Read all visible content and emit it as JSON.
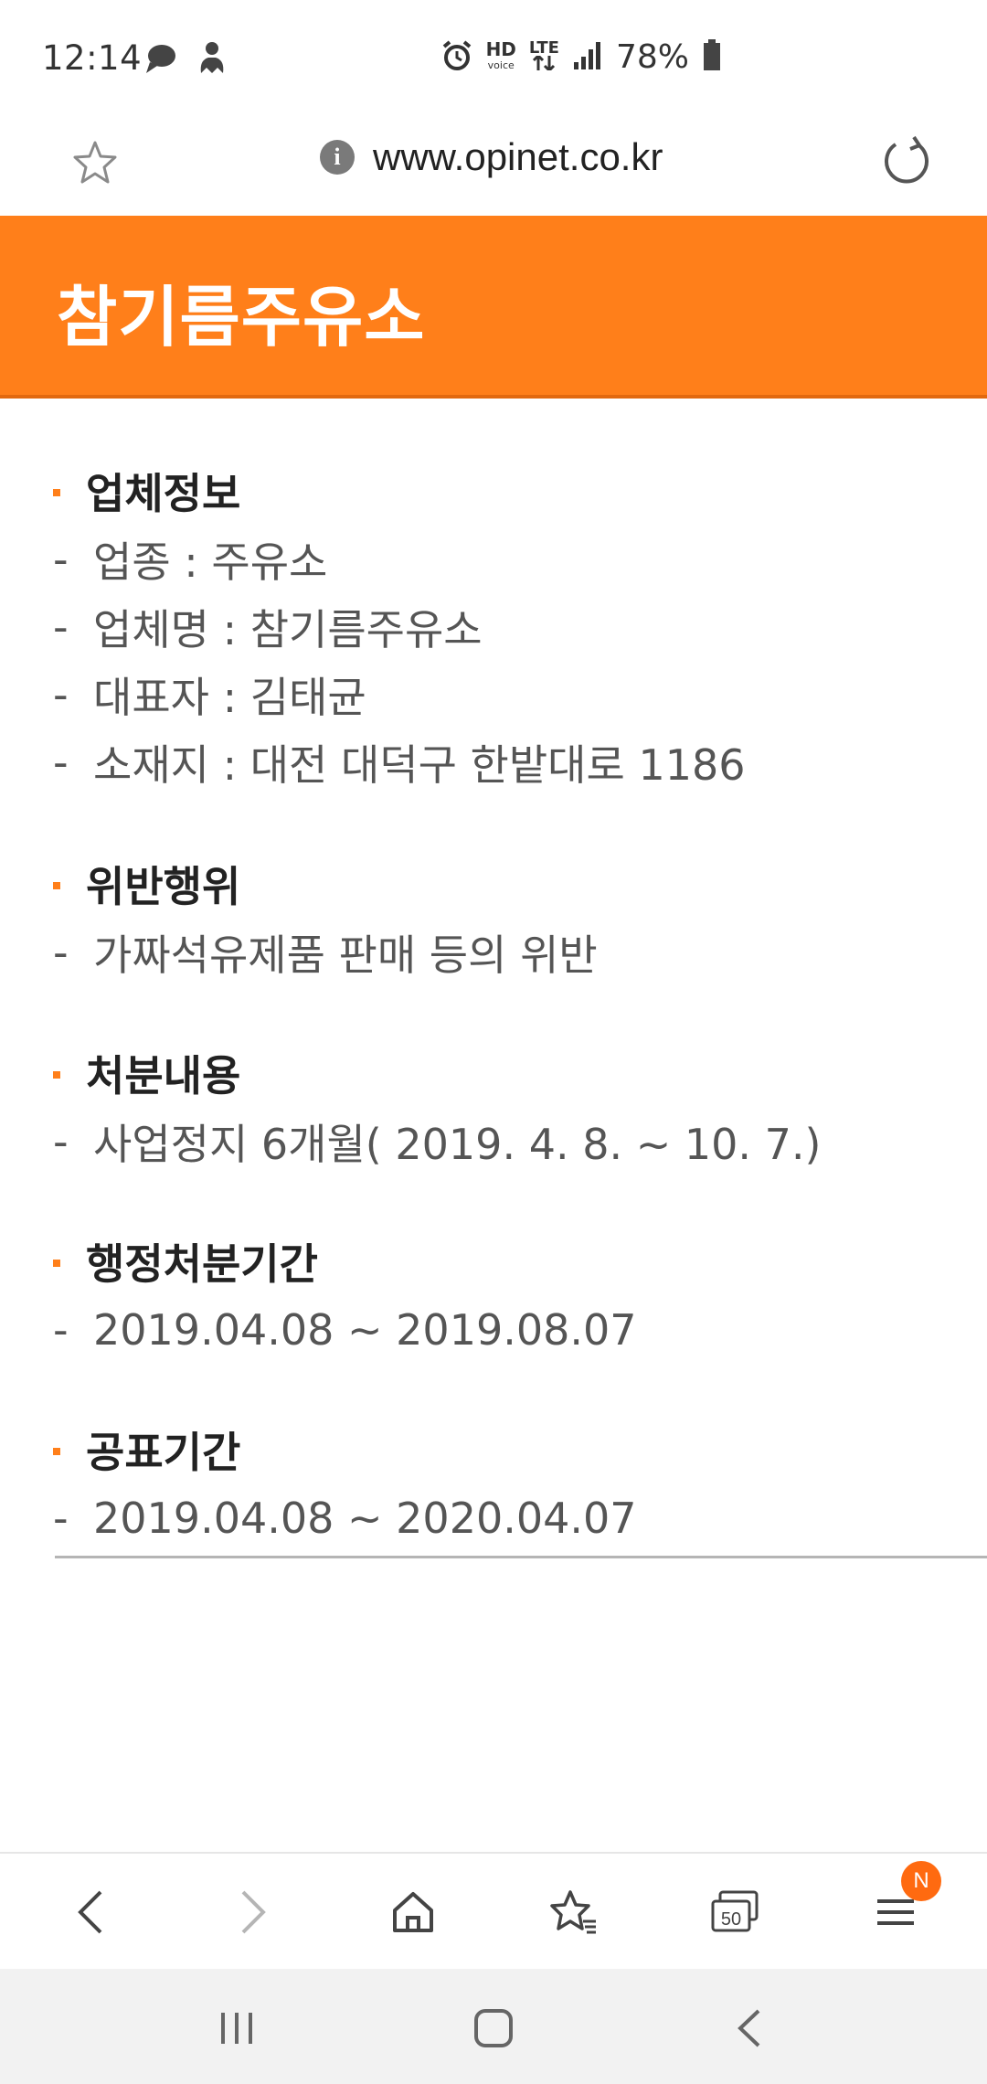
{
  "status_bar": {
    "time": "12:14",
    "battery": "78%",
    "left_icons": [
      "chat-icon",
      "person-icon"
    ],
    "right_icons": [
      "alarm-icon",
      "hd-voice-icon",
      "lte-icon",
      "signal-icon",
      "battery-icon"
    ],
    "hd_label": "HD",
    "voice_label": "voice",
    "lte_label": "LTE"
  },
  "browser": {
    "url": "www.opinet.co.kr",
    "info_glyph": "i"
  },
  "page": {
    "title": "참기름주유소",
    "sections": [
      {
        "title": "업체정보",
        "lines": [
          "업종 : 주유소",
          "업체명 : 참기름주유소",
          "대표자 : 김태균",
          "소재지 : 대전 대덕구 한밭대로 1186"
        ]
      },
      {
        "title": "위반행위",
        "lines": [
          "가짜석유제품 판매 등의 위반"
        ]
      },
      {
        "title": "처분내용",
        "lines": [
          "사업정지 6개월( 2019. 4. 8. ~ 10. 7.)"
        ]
      },
      {
        "title": "행정처분기간",
        "lines": [
          "2019.04.08 ~ 2019.08.07"
        ]
      },
      {
        "title": "공표기간",
        "lines": [
          "2019.04.08 ~ 2020.04.07"
        ]
      }
    ],
    "dash": "-"
  },
  "toolbar": {
    "tabs_count": "50",
    "menu_badge": "N"
  },
  "colors": {
    "accent": "#ff7f1a",
    "accent_dark": "#e2690f",
    "badge": "#ff6a10"
  }
}
